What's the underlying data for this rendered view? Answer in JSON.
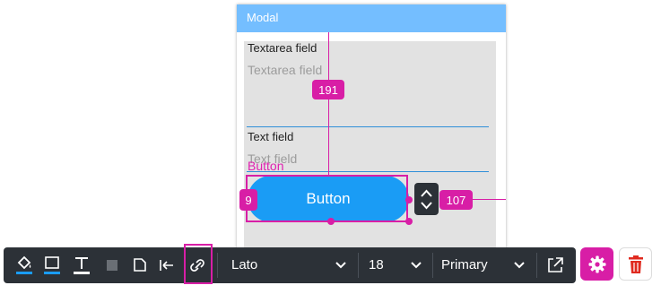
{
  "modal": {
    "title": "Modal",
    "textarea": {
      "label": "Textarea field",
      "placeholder": "Textarea field"
    },
    "textfield": {
      "label": "Text field",
      "placeholder": "Text field"
    },
    "button_caption": "Button",
    "button_label": "Button"
  },
  "selection": {
    "top_distance": "191",
    "left_distance": "9",
    "right_distance": "107"
  },
  "toolbar": {
    "font_family": "Lato",
    "font_size": "18",
    "style": "Primary",
    "icons": [
      "fill-color-icon",
      "border-color-icon",
      "text-color-icon",
      "shadow-icon",
      "corner-icon",
      "align-left-icon",
      "link-icon",
      "external-link-icon"
    ]
  },
  "actions": {
    "settings": "gear-icon",
    "delete": "trash-icon"
  },
  "colors": {
    "accent": "#d81ea6",
    "modal_header": "#74beff",
    "button_primary": "#1a9cf5",
    "toolbar_bg": "#2c3137",
    "delete_red": "#e02a1f"
  }
}
